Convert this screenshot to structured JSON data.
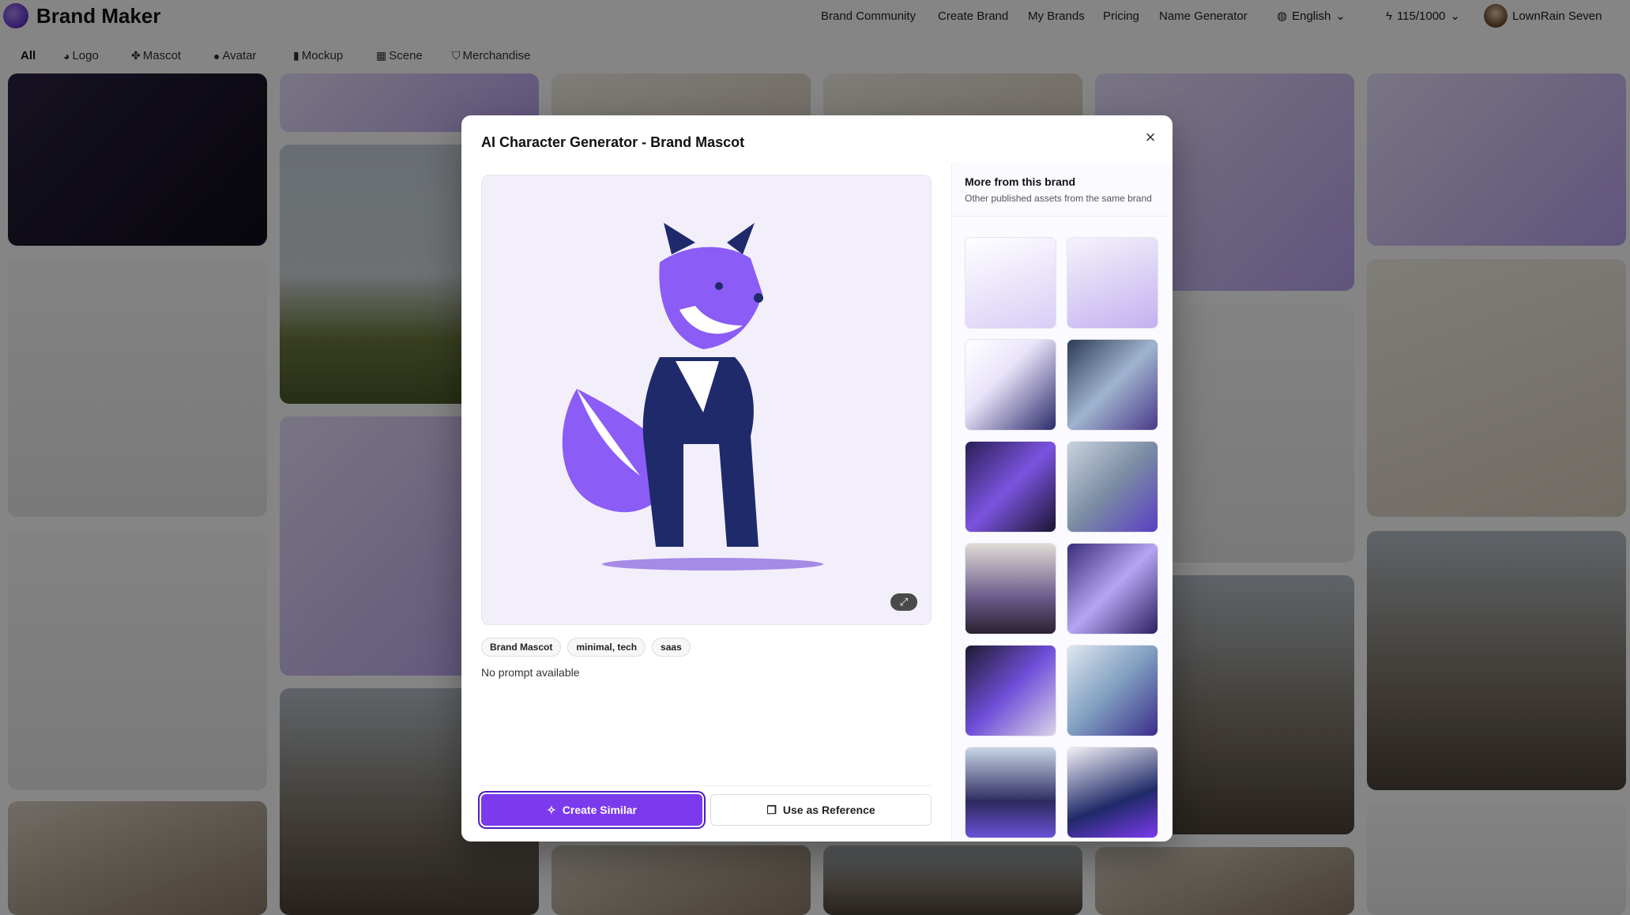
{
  "app": {
    "name": "Brand Maker"
  },
  "nav": {
    "links": [
      "Brand Community",
      "Create Brand",
      "My Brands",
      "Pricing",
      "Name Generator"
    ],
    "language": "English",
    "credits": "115/1000",
    "user_name": "LownRain Seven"
  },
  "categories": [
    "All",
    "Logo",
    "Mascot",
    "Avatar",
    "Mockup",
    "Scene",
    "Merchandise"
  ],
  "modal": {
    "title": "AI Character Generator - Brand Mascot",
    "tags": [
      "Brand Mascot",
      "minimal, tech",
      "saas"
    ],
    "prompt": "No prompt available",
    "create_similar_label": "Create Similar",
    "use_reference_label": "Use as Reference",
    "more_title": "More from this brand",
    "more_subtitle": "Other published assets from the same brand",
    "thumbnail_count": 12
  },
  "colors": {
    "accent": "#7c3aed",
    "overlay": "rgba(0,0,0,0.48)"
  }
}
